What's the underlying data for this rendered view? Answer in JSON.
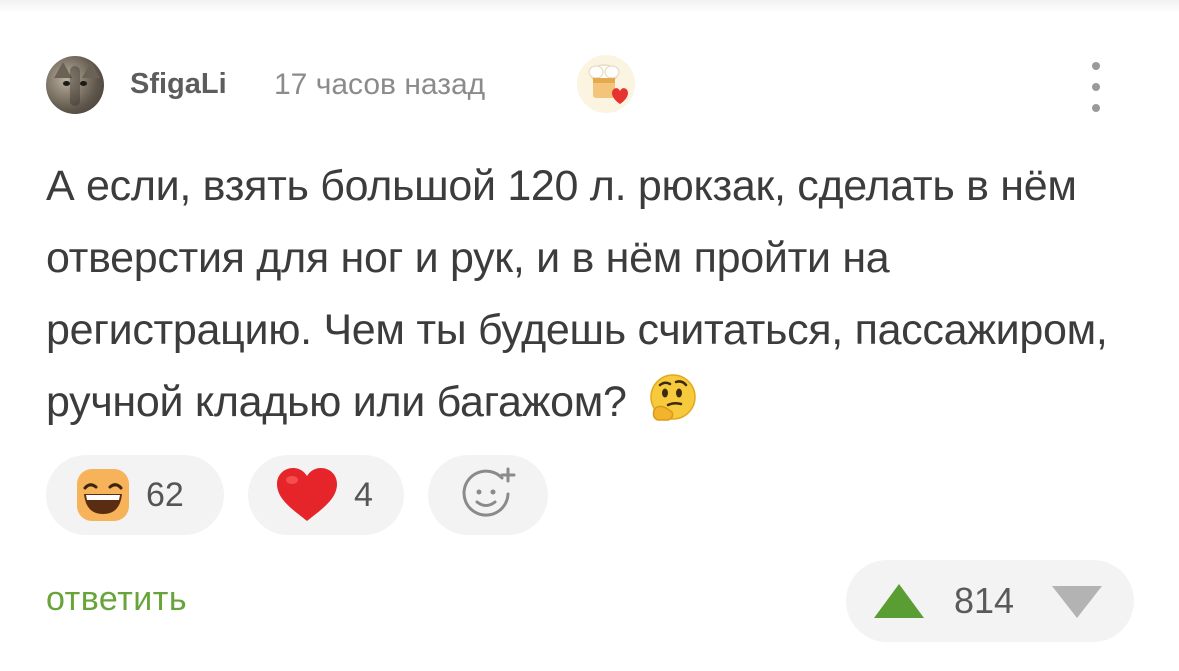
{
  "comment": {
    "author": "SfigaLi",
    "timestamp": "17 часов назад",
    "text": "А если, взять большой 120 л. рюкзак, сделать в нём отверстия для ног и рук, и в нём пройти на регистрацию. Чем ты будешь считаться, пассажиром, ручной кладью или багажом?",
    "text_trailing_emoji": "thinking-face-emoji",
    "author_badge_icon": "chef-heart-badge-icon",
    "menu_icon": "more-vertical-icon"
  },
  "reactions": [
    {
      "icon": "laughing-face-emoji",
      "count": "62"
    },
    {
      "icon": "red-heart-emoji",
      "count": "4"
    },
    {
      "icon": "add-reaction-icon",
      "count": ""
    }
  ],
  "actions": {
    "reply_label": "ответить"
  },
  "rating": {
    "value": "814",
    "upvote_icon": "triangle-up-icon",
    "downvote_icon": "triangle-down-icon"
  },
  "colors": {
    "accent_green": "#5a9e33",
    "reply_green": "#67a43a",
    "pill_bg": "#f3f3f3"
  }
}
